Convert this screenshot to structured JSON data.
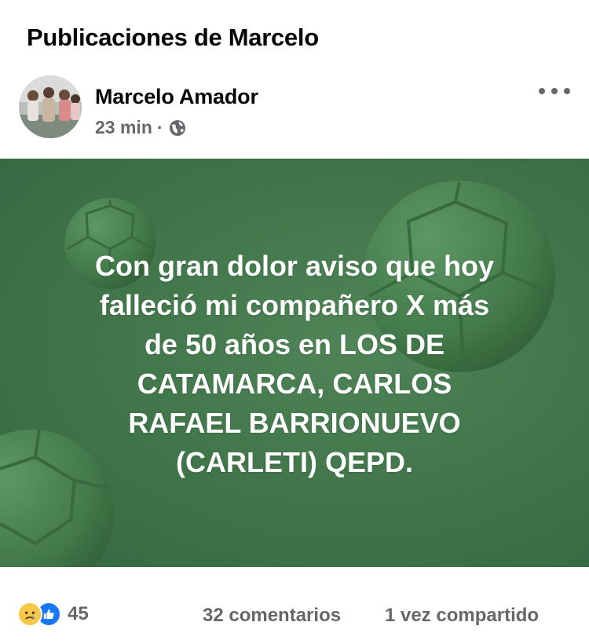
{
  "page": {
    "title": "Publicaciones de Marcelo"
  },
  "post": {
    "author": "Marcelo Amador",
    "time": "23 min",
    "separator": "·",
    "audience_icon": "globe-icon",
    "more_icon": "more-options-icon",
    "text": "Con gran dolor  aviso que hoy\nfalleció  mi compañero  X más\nde 50 años en  LOS DE\nCATAMARCA, CARLOS\nRAFAEL BARRIONUEVO\n(CARLETI) QEPD.",
    "background_color": "#3f7448"
  },
  "reactions": {
    "icons": [
      "sad-icon",
      "like-icon"
    ],
    "count": "45",
    "comments": "32 comentarios",
    "shares": "1 vez compartido"
  },
  "colors": {
    "meta_text": "#65676b",
    "like_blue": "#1877f2",
    "sad_yellow": "#f7c84a"
  }
}
